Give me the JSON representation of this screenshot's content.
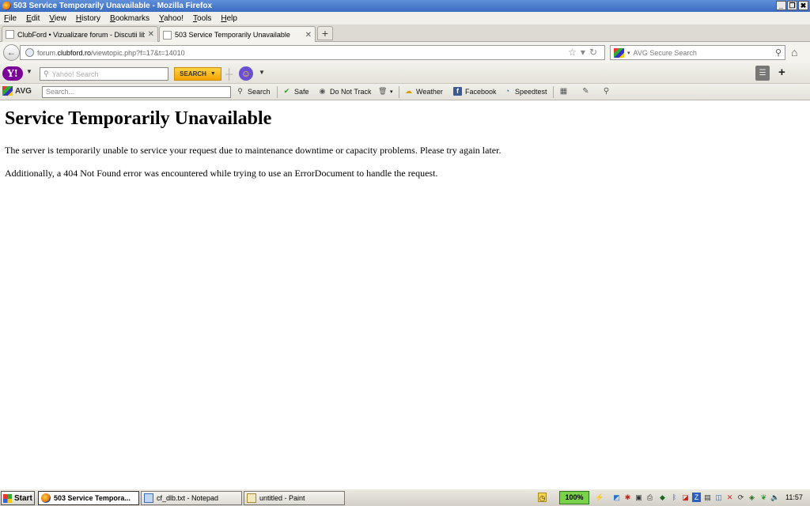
{
  "window": {
    "title": "503 Service Temporarily Unavailable - Mozilla Firefox",
    "controls": [
      "_",
      "❐",
      "✖"
    ]
  },
  "menu": [
    "File",
    "Edit",
    "View",
    "History",
    "Bookmarks",
    "Yahoo!",
    "Tools",
    "Help"
  ],
  "tabs": [
    {
      "title": "ClubFord • Vizualizare forum - Discutii libe...",
      "active": false
    },
    {
      "title": "503 Service Temporarily Unavailable",
      "active": true
    }
  ],
  "newtab_label": "+",
  "address": {
    "prefix": "forum.",
    "domain": "clubford.ro",
    "path": "/viewtopic.php?f=17&t=14010"
  },
  "search": {
    "placeholder": "AVG Secure Search"
  },
  "yahoo_toolbar": {
    "logo": "Y!",
    "search_placeholder": "Yahoo! Search",
    "search_button": "SEARCH"
  },
  "avg_toolbar": {
    "logo": "AVG",
    "search_placeholder": "Search...",
    "search_label": "Search",
    "safe_label": "Safe",
    "dnt_label": "Do Not Track",
    "weather_label": "Weather",
    "facebook_label": "Facebook",
    "speedtest_label": "Speedtest"
  },
  "page": {
    "heading": "Service Temporarily Unavailable",
    "paragraph1": "The server is temporarily unable to service your request due to maintenance downtime or capacity problems. Please try again later.",
    "paragraph2": "Additionally, a 404 Not Found error was encountered while trying to use an ErrorDocument to handle the request."
  },
  "taskbar": {
    "start": "Start",
    "items": [
      {
        "label": "503 Service Tempora...",
        "active": true
      },
      {
        "label": "cf_dlb.txt - Notepad",
        "active": false
      },
      {
        "label": "untitled - Paint",
        "active": false
      }
    ],
    "zoom": "100%",
    "clock": "11:57"
  }
}
